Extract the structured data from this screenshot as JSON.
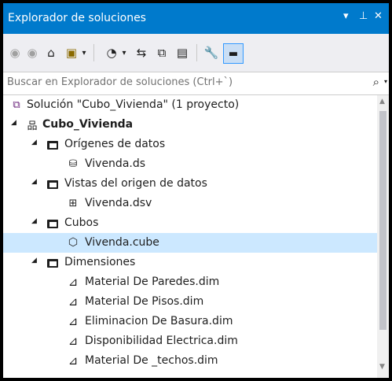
{
  "panel": {
    "title": "Explorador de soluciones",
    "dropdown_glyph": "▾",
    "pin_glyph": "⊥",
    "close_glyph": "✕"
  },
  "toolbar": {
    "back_glyph": "◉",
    "forward_glyph": "◉",
    "home_glyph": "⌂",
    "switch_views_glyph": "▣",
    "switch_views_dd": "▾",
    "pending_changes_glyph": "◔",
    "pending_changes_dd": "▾",
    "sync_glyph": "⇆",
    "collapse_glyph": "⧉",
    "show_all_glyph": "▤",
    "properties_glyph": "🔧",
    "preview_glyph": "▬"
  },
  "search": {
    "placeholder": "Buscar en Explorador de soluciones (Ctrl+`)",
    "icon_glyph": "⌕",
    "dropdown_glyph": "▾"
  },
  "tree": {
    "expand_glyph": "◢",
    "items": [
      {
        "label": "Solución \"Cubo_Vivienda\" (1 proyecto)",
        "icon": "solution-icon",
        "glyph": "⧉"
      },
      {
        "label": "Cubo_Vivienda",
        "icon": "project-icon",
        "glyph": "品"
      },
      {
        "label": "Orígenes de datos",
        "icon": "folder-icon"
      },
      {
        "label": "Vivenda.ds",
        "icon": "datasource-icon",
        "glyph": "⛁"
      },
      {
        "label": "Vistas del origen de datos",
        "icon": "folder-icon"
      },
      {
        "label": "Vivenda.dsv",
        "icon": "datasource-view-icon",
        "glyph": "⊞"
      },
      {
        "label": "Cubos",
        "icon": "folder-icon"
      },
      {
        "label": "Vivenda.cube",
        "icon": "cube-icon",
        "glyph": "⬡"
      },
      {
        "label": "Dimensiones",
        "icon": "folder-icon"
      },
      {
        "label": "Material De Paredes.dim",
        "icon": "dimension-icon",
        "glyph": "⊿"
      },
      {
        "label": "Material De Pisos.dim",
        "icon": "dimension-icon",
        "glyph": "⊿"
      },
      {
        "label": "Eliminacion De Basura.dim",
        "icon": "dimension-icon",
        "glyph": "⊿"
      },
      {
        "label": "Disponibilidad Electrica.dim",
        "icon": "dimension-icon",
        "glyph": "⊿"
      },
      {
        "label": "Material De _techos.dim",
        "icon": "dimension-icon",
        "glyph": "⊿"
      }
    ]
  },
  "scrollbar": {
    "up_glyph": "▲",
    "down_glyph": "▼"
  }
}
